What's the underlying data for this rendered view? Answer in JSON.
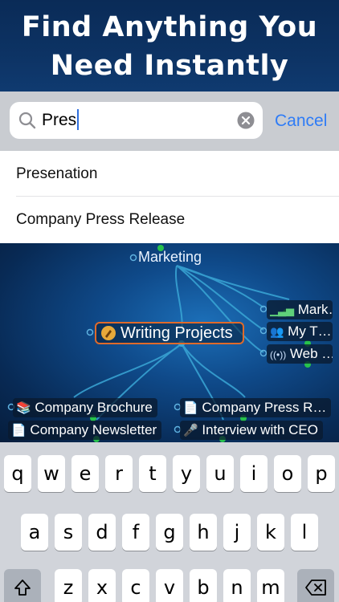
{
  "banner": {
    "line1": "Find Anything You",
    "line2": "Need Instantly"
  },
  "search": {
    "query": "Pres",
    "cancel_label": "Cancel"
  },
  "results": [
    "Presenation",
    "Company Press Release"
  ],
  "mindmap": {
    "top_topic": "Marketing",
    "central_topic": "Writing Projects",
    "right_topics": [
      "Mark…",
      "My T…",
      "Web …"
    ],
    "bottom_left_topics": [
      "Company Brochure",
      "Company Newsletter"
    ],
    "bottom_right_topics": [
      "Company Press R…",
      "Interview with CEO"
    ]
  },
  "keyboard": {
    "row1": [
      "q",
      "w",
      "e",
      "r",
      "t",
      "y",
      "u",
      "i",
      "o",
      "p"
    ],
    "row2": [
      "a",
      "s",
      "d",
      "f",
      "g",
      "h",
      "j",
      "k",
      "l"
    ],
    "row3": [
      "z",
      "x",
      "c",
      "v",
      "b",
      "n",
      "m"
    ],
    "shift_icon": "shift-icon",
    "backspace_icon": "backspace-icon"
  },
  "colors": {
    "accent": "#2f7cf6",
    "central_border": "#e06a2a",
    "connector": "#3aa7d6",
    "node_dot": "#27c24c"
  }
}
